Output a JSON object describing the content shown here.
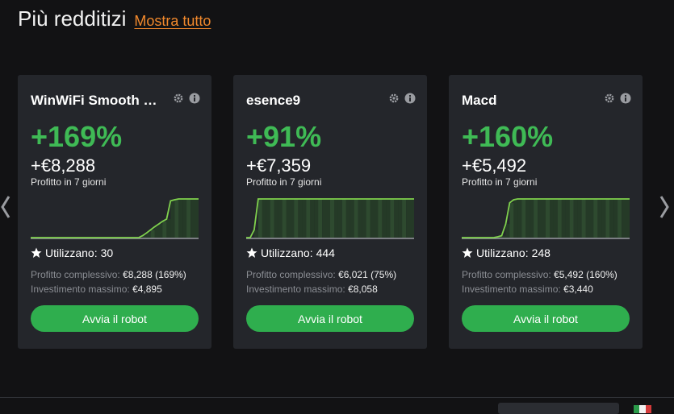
{
  "section": {
    "title": "Più redditizi",
    "link": "Mostra tutto"
  },
  "cards": [
    {
      "name": "WinWiFi Smooth C...",
      "percent": "+169%",
      "profit": "+€8,288",
      "profit_label": "Profitto in 7 giorni",
      "users_label": "Utilizzano:",
      "users_count": "30",
      "total_label": "Profitto complessivo:",
      "total_value": "€8,288 (169%)",
      "max_label": "Investimento massimo:",
      "max_value": "€4,895",
      "button": "Avvia il robot",
      "chart": [
        0,
        0,
        0,
        0,
        0,
        0,
        0,
        0,
        0,
        0,
        0,
        0,
        0,
        0,
        0,
        0,
        0,
        0,
        0,
        0,
        0,
        0,
        0,
        0,
        0,
        0,
        0,
        0,
        0.05,
        0.12,
        0.2,
        0.28,
        0.35,
        0.42,
        0.48,
        0.95,
        0.98,
        1,
        1,
        1,
        1,
        1,
        1
      ]
    },
    {
      "name": "esence9",
      "percent": "+91%",
      "profit": "+€7,359",
      "profit_label": "Profitto in 7 giorni",
      "users_label": "Utilizzano:",
      "users_count": "444",
      "total_label": "Profitto complessivo:",
      "total_value": "€6,021 (75%)",
      "max_label": "Investimento massimo:",
      "max_value": "€8,058",
      "button": "Avvia il robot",
      "chart": [
        0,
        0,
        0.2,
        1,
        1,
        1,
        1,
        1,
        1,
        1,
        1,
        1,
        1,
        1,
        1,
        1,
        1,
        1,
        1,
        1,
        1,
        1,
        1,
        1,
        1,
        1,
        1,
        1,
        1,
        1,
        1,
        1,
        1,
        1,
        1,
        1,
        1,
        1,
        1,
        1,
        1,
        1,
        1
      ]
    },
    {
      "name": "Macd",
      "percent": "+160%",
      "profit": "+€5,492",
      "profit_label": "Profitto in 7 giorni",
      "users_label": "Utilizzano:",
      "users_count": "248",
      "total_label": "Profitto complessivo:",
      "total_value": "€5,492 (160%)",
      "max_label": "Investimento massimo:",
      "max_value": "€3,440",
      "button": "Avvia il robot",
      "chart": [
        0,
        0,
        0,
        0,
        0,
        0,
        0,
        0,
        0,
        0.02,
        0.05,
        0.35,
        0.9,
        0.98,
        1,
        1,
        1,
        1,
        1,
        1,
        1,
        1,
        1,
        1,
        1,
        1,
        1,
        1,
        1,
        1,
        1,
        1,
        1,
        1,
        1,
        1,
        1,
        1,
        1,
        1,
        1,
        1,
        1
      ]
    }
  ],
  "colors": {
    "accent_green": "#3fba55",
    "button_green": "#2fae4e",
    "link_orange": "#f0882c",
    "card_bg": "#24262b"
  },
  "icons": {
    "settings": "gear-icon",
    "info": "info-icon",
    "users": "star-icon",
    "prev": "chevron-left-icon",
    "next": "chevron-right-icon"
  }
}
